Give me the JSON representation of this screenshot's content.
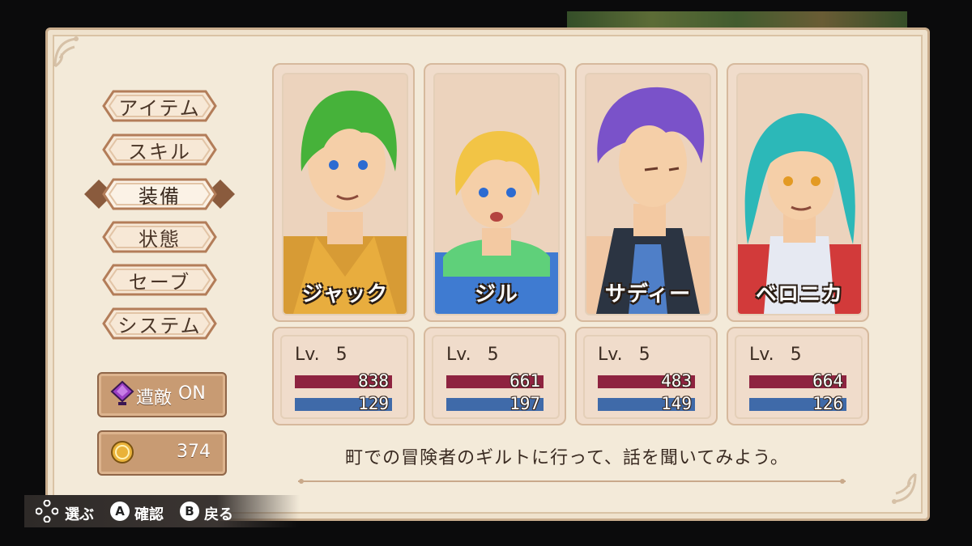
{
  "menu": {
    "items": [
      {
        "label": "アイテム"
      },
      {
        "label": "スキル"
      },
      {
        "label": "装備",
        "selected": true
      },
      {
        "label": "状態"
      },
      {
        "label": "セーブ"
      },
      {
        "label": "システム"
      }
    ]
  },
  "encounter": {
    "label": "遭敵",
    "state": "ON",
    "icon": "gem-icon"
  },
  "gold": {
    "value": "374",
    "icon": "coin-icon"
  },
  "party": [
    {
      "name": "ジャック",
      "lv_label": "Lv.",
      "lv": "5",
      "hp": "838",
      "mp": "129",
      "hair": "#4fbf3a"
    },
    {
      "name": "ジル",
      "lv_label": "Lv.",
      "lv": "5",
      "hp": "661",
      "mp": "197",
      "hair": "#f2c445"
    },
    {
      "name": "サディー",
      "lv_label": "Lv.",
      "lv": "5",
      "hp": "483",
      "mp": "149",
      "hair": "#7a52c9"
    },
    {
      "name": "ベロニカ",
      "lv_label": "Lv.",
      "lv": "5",
      "hp": "664",
      "mp": "126",
      "hair": "#2cb8b8"
    }
  ],
  "message": "町での冒険者のギルトに行って、話を聞いてみよう。",
  "controls": {
    "dpad_label": "選ぶ",
    "a_glyph": "A",
    "a_label": "確認",
    "b_glyph": "B",
    "b_label": "戻る"
  },
  "colors": {
    "hp_bar": "#8e2340",
    "mp_bar": "#3f6aa9",
    "panel": "#f3ead9",
    "button": "#c89b73"
  }
}
